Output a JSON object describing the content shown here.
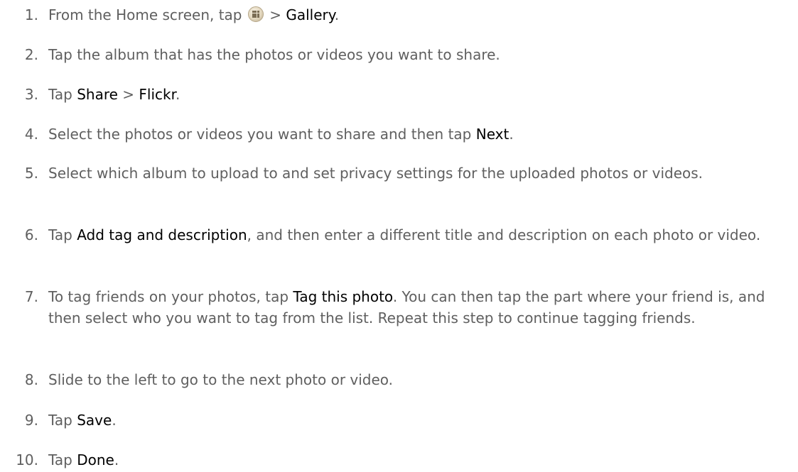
{
  "steps": [
    {
      "number": "1.",
      "parts": [
        {
          "t": "From the Home screen, tap "
        },
        {
          "icon": "apps-icon"
        },
        {
          "t": " > "
        },
        {
          "t": "Gallery",
          "em": true
        },
        {
          "t": "."
        }
      ]
    },
    {
      "number": "2.",
      "parts": [
        {
          "t": "Tap the album that has the photos or videos you want to share."
        }
      ]
    },
    {
      "number": "3.",
      "parts": [
        {
          "t": "Tap "
        },
        {
          "t": "Share",
          "em": true
        },
        {
          "t": " > "
        },
        {
          "t": "Flickr",
          "em": true
        },
        {
          "t": "."
        }
      ]
    },
    {
      "number": "4.",
      "parts": [
        {
          "t": "Select the photos or videos you want to share and then tap "
        },
        {
          "t": "Next",
          "em": true
        },
        {
          "t": "."
        }
      ]
    },
    {
      "number": "5.",
      "parts": [
        {
          "t": "Select which album to upload to and set privacy settings for the uploaded photos or videos."
        }
      ]
    },
    {
      "number": "6.",
      "parts": [
        {
          "t": "Tap "
        },
        {
          "t": "Add tag and description",
          "em": true
        },
        {
          "t": ", and then enter a different title and description on each photo or video."
        }
      ]
    },
    {
      "number": "7.",
      "parts": [
        {
          "t": "To tag friends on your photos, tap "
        },
        {
          "t": "Tag this photo",
          "em": true
        },
        {
          "t": ". You can then tap the part where your friend is, and then select who you want to tag from the list. Repeat this step to continue tagging friends."
        }
      ]
    },
    {
      "number": "8.",
      "parts": [
        {
          "t": "Slide to the left to go to the next photo or video."
        }
      ]
    },
    {
      "number": "9.",
      "parts": [
        {
          "t": "Tap "
        },
        {
          "t": "Save",
          "em": true
        },
        {
          "t": "."
        }
      ]
    },
    {
      "number": "10.",
      "parts": [
        {
          "t": "Tap "
        },
        {
          "t": "Done",
          "em": true
        },
        {
          "t": "."
        }
      ]
    }
  ]
}
